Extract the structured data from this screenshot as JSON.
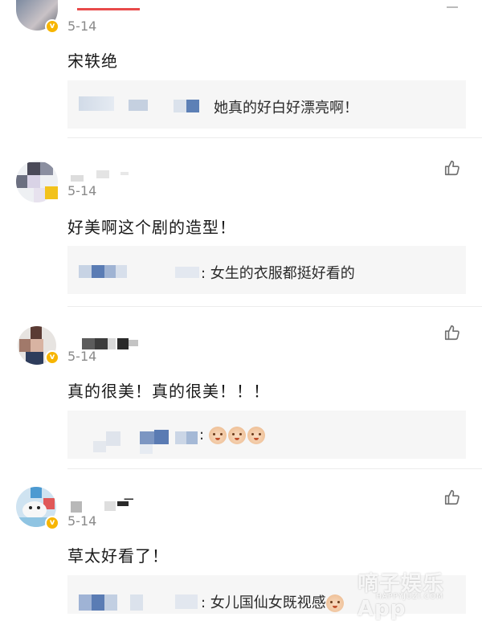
{
  "comments": [
    {
      "date": "5-14",
      "text": "宋轶绝",
      "reply": {
        "text": "她真的好白好漂亮啊！"
      }
    },
    {
      "date": "5-14",
      "text": "好美啊这个剧的造型！",
      "reply": {
        "text": "女生的衣服都挺好看的"
      }
    },
    {
      "date": "5-14",
      "text": "真的很美！真的很美！！！",
      "reply": {
        "text": ""
      }
    },
    {
      "date": "5-14",
      "text": "草太好看了！",
      "reply": {
        "text": "女儿国仙女既视感"
      }
    }
  ],
  "watermark": {
    "main": "嘀子娱乐App",
    "sub": "HAPPYJUZI.COM"
  },
  "colors": {
    "verified_badge": "#f7b500",
    "top_accent": "#e84a4a",
    "reply_bg": "#f6f6f6"
  }
}
